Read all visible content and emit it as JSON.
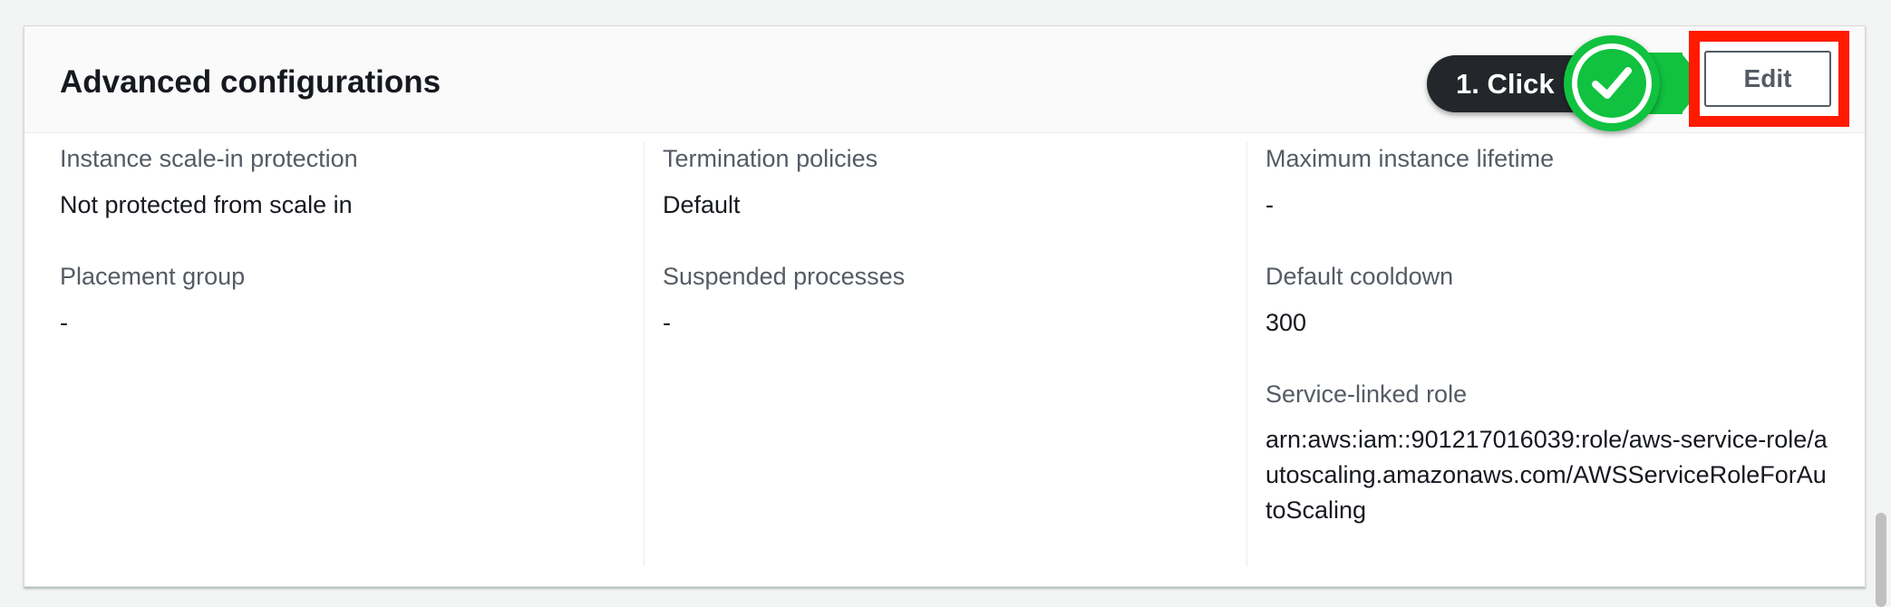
{
  "panel": {
    "title": "Advanced configurations",
    "edit_label": "Edit"
  },
  "annotation": {
    "callout_text": "1. Click",
    "check_icon": "check-circle-icon",
    "highlight_color": "#ff1a00",
    "arrow_color": "#10c23f"
  },
  "columns": [
    {
      "fields": [
        {
          "label": "Instance scale-in protection",
          "value": "Not protected from scale in"
        },
        {
          "label": "Placement group",
          "value": "-"
        }
      ]
    },
    {
      "fields": [
        {
          "label": "Termination policies",
          "value": "Default"
        },
        {
          "label": "Suspended processes",
          "value": "-"
        }
      ]
    },
    {
      "fields": [
        {
          "label": "Maximum instance lifetime",
          "value": "-"
        },
        {
          "label": "Default cooldown",
          "value": "300"
        },
        {
          "label": "Service-linked role",
          "value": "arn:aws:iam::901217016039:role/aws-service-role/autoscaling.amazonaws.com/AWSServiceRoleForAutoScaling"
        }
      ]
    }
  ]
}
